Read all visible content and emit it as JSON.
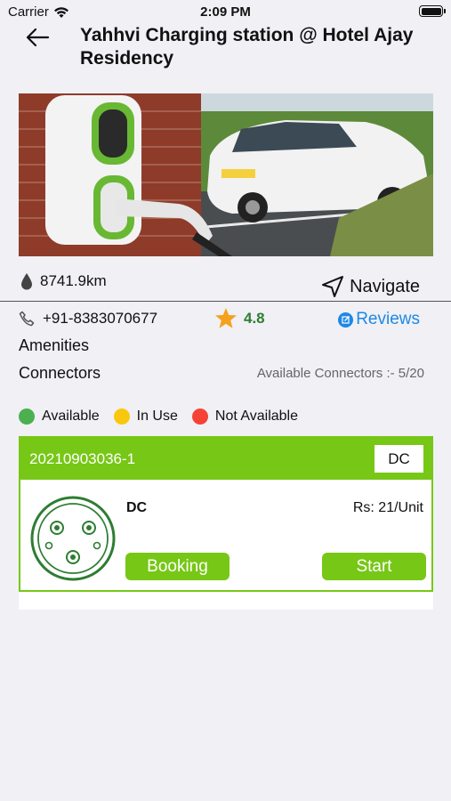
{
  "status_bar": {
    "carrier": "Carrier",
    "time": "2:09 PM",
    "wifi_icon": "wifi-icon",
    "battery_icon": "battery-icon"
  },
  "header": {
    "back_icon": "arrow-left-icon",
    "title": "Yahhvi Charging station @ Hotel Ajay Residency"
  },
  "hero_image": "ev-charging-photo",
  "info": {
    "distance": "8741.9km",
    "distance_icon": "drop-icon",
    "navigate_label": "Navigate",
    "navigate_icon": "navigation-arrow-icon",
    "phone": "+91-8383070677",
    "phone_icon": "phone-icon",
    "rating": "4.8",
    "rating_icon": "star-icon",
    "reviews_label": "Reviews",
    "reviews_icon": "edit-icon",
    "amenities_label": "Amenities",
    "connectors_label": "Connectors",
    "available_connectors": "Available Connectors :- 5/20"
  },
  "legend": [
    {
      "label": "Available",
      "color": "#4caf50"
    },
    {
      "label": "In Use",
      "color": "#f9c80e"
    },
    {
      "label": "Not Available",
      "color": "#f44336"
    }
  ],
  "connector_card": {
    "id": "20210903036-1",
    "type_badge": "DC",
    "connector_name": "DC",
    "price": "Rs: 21/Unit",
    "booking_label": "Booking",
    "start_label": "Start",
    "accent_color": "#77c716",
    "plug_icon": "connector-plug-icon"
  }
}
